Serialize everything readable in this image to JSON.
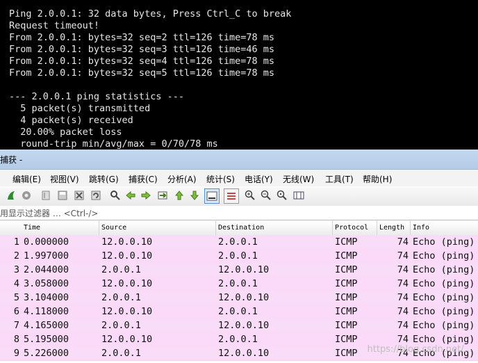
{
  "terminal": {
    "lines": [
      "Ping 2.0.0.1: 32 data bytes, Press Ctrl_C to break",
      "Request timeout!",
      "From 2.0.0.1: bytes=32 seq=2 ttl=126 time=78 ms",
      "From 2.0.0.1: bytes=32 seq=3 ttl=126 time=46 ms",
      "From 2.0.0.1: bytes=32 seq=4 ttl=126 time=78 ms",
      "From 2.0.0.1: bytes=32 seq=5 ttl=126 time=78 ms",
      "",
      "--- 2.0.0.1 ping statistics ---",
      "  5 packet(s) transmitted",
      "  4 packet(s) received",
      "  20.00% packet loss",
      "  round-trip min/avg/max = 0/70/78 ms"
    ]
  },
  "window": {
    "title": "捕获 -"
  },
  "menu": {
    "items": [
      "编辑(E)",
      "视图(V)",
      "跳转(G)",
      "捕获(C)",
      "分析(A)",
      "统计(S)",
      "电话(Y)",
      "无线(W)",
      "工具(T)",
      "帮助(H)"
    ]
  },
  "toolbar": {
    "icons": [
      "shark-fin-icon",
      "capture-options-icon",
      "open-file-icon",
      "save-file-icon",
      "close-file-icon",
      "reload-icon",
      "find-icon",
      "back-icon",
      "forward-icon",
      "go-to-packet-icon",
      "first-packet-icon",
      "last-packet-icon",
      "autoscroll-icon",
      "colorize-icon",
      "zoom-in-icon",
      "zoom-out-icon",
      "zoom-reset-icon",
      "resize-columns-icon"
    ]
  },
  "filter": {
    "placeholder": "用显示过滤器 … <Ctrl-/>"
  },
  "packet_list": {
    "columns": [
      "Time",
      "Source",
      "Destination",
      "Protocol",
      "Length",
      "Info"
    ],
    "rows": [
      {
        "no": "1",
        "time": "0.000000",
        "source": "12.0.0.10",
        "destination": "2.0.0.1",
        "protocol": "ICMP",
        "length": "74",
        "info": "Echo (ping)"
      },
      {
        "no": "2",
        "time": "1.997000",
        "source": "12.0.0.10",
        "destination": "2.0.0.1",
        "protocol": "ICMP",
        "length": "74",
        "info": "Echo (ping)"
      },
      {
        "no": "3",
        "time": "2.044000",
        "source": "2.0.0.1",
        "destination": "12.0.0.10",
        "protocol": "ICMP",
        "length": "74",
        "info": "Echo (ping)"
      },
      {
        "no": "4",
        "time": "3.058000",
        "source": "12.0.0.10",
        "destination": "2.0.0.1",
        "protocol": "ICMP",
        "length": "74",
        "info": "Echo (ping)"
      },
      {
        "no": "5",
        "time": "3.104000",
        "source": "2.0.0.1",
        "destination": "12.0.0.10",
        "protocol": "ICMP",
        "length": "74",
        "info": "Echo (ping)"
      },
      {
        "no": "6",
        "time": "4.118000",
        "source": "12.0.0.10",
        "destination": "2.0.0.1",
        "protocol": "ICMP",
        "length": "74",
        "info": "Echo (ping)"
      },
      {
        "no": "7",
        "time": "4.165000",
        "source": "2.0.0.1",
        "destination": "12.0.0.10",
        "protocol": "ICMP",
        "length": "74",
        "info": "Echo (ping)"
      },
      {
        "no": "8",
        "time": "5.195000",
        "source": "12.0.0.10",
        "destination": "2.0.0.1",
        "protocol": "ICMP",
        "length": "74",
        "info": "Echo (ping)"
      },
      {
        "no": "9",
        "time": "5.226000",
        "source": "2.0.0.1",
        "destination": "12.0.0.10",
        "protocol": "ICMP",
        "length": "74",
        "info": "Echo (ping)"
      }
    ]
  },
  "watermark": "https://blog.csdn.net/..."
}
